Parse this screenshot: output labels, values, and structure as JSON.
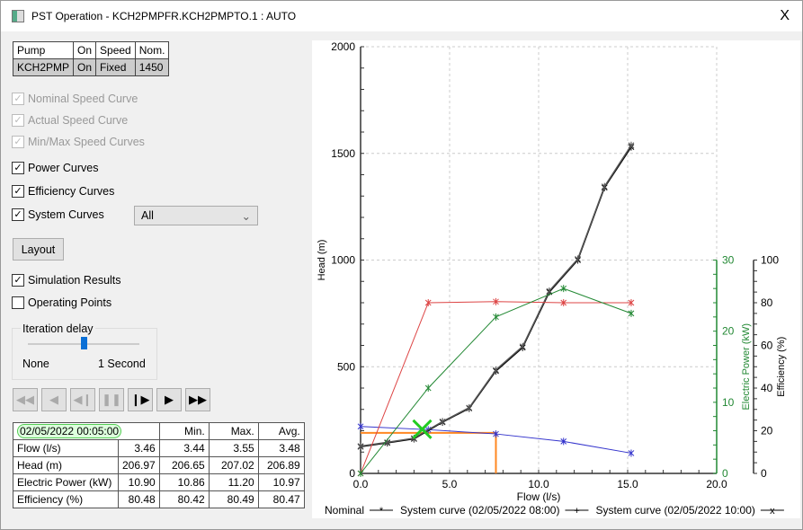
{
  "window": {
    "title": "PST Operation - KCH2PMPFR.KCH2PMPTO.1 : AUTO",
    "close": "X"
  },
  "pump_table": {
    "headers": [
      "Pump",
      "On",
      "Speed",
      "Nom."
    ],
    "row": [
      "KCH2PMP",
      "On",
      "Fixed",
      "1450"
    ],
    "on_color": "#11cc11"
  },
  "options": [
    {
      "label": "Nominal Speed Curve",
      "checked": true,
      "disabled": true
    },
    {
      "label": "Actual Speed Curve",
      "checked": true,
      "disabled": true
    },
    {
      "label": "Min/Max Speed Curves",
      "checked": true,
      "disabled": true
    },
    {
      "label": "Power Curves",
      "checked": true,
      "disabled": false
    },
    {
      "label": "Efficiency Curves",
      "checked": true,
      "disabled": false
    },
    {
      "label": "System Curves",
      "checked": true,
      "disabled": false
    }
  ],
  "system_curves_select": {
    "value": "All"
  },
  "layout_button": "Layout",
  "simulation_results": {
    "label": "Simulation Results",
    "checked": true
  },
  "operating_points": {
    "label": "Operating Points",
    "checked": false
  },
  "iteration_delay": {
    "label": "Iteration delay",
    "min_label": "None",
    "max_label": "1 Second",
    "value_fraction": 0.5
  },
  "playback": {
    "buttons": [
      "rewind",
      "step-back",
      "step-back-frame",
      "pause",
      "step-forward",
      "play",
      "fast-forward"
    ]
  },
  "stats": {
    "timestamp": "02/05/2022 00:05:00",
    "headers": [
      "Min.",
      "Max.",
      "Avg."
    ],
    "rows": [
      {
        "label": "Flow (l/s)",
        "values": [
          "3.46",
          "3.44",
          "3.55",
          "3.48"
        ]
      },
      {
        "label": "Head (m)",
        "values": [
          "206.97",
          "206.65",
          "207.02",
          "206.89"
        ]
      },
      {
        "label": "Electric Power (kW)",
        "values": [
          "10.90",
          "10.86",
          "11.20",
          "10.97"
        ]
      },
      {
        "label": "Efficiency (%)",
        "values": [
          "80.48",
          "80.42",
          "80.49",
          "80.47"
        ]
      }
    ]
  },
  "chart_data": {
    "type": "line",
    "xlabel": "Flow (l/s)",
    "ylabel": "Head (m)",
    "y2label": "Electric Power (kW)",
    "y3label": "Efficiency (%)",
    "xlim": [
      0,
      20
    ],
    "ylim": [
      0,
      2000
    ],
    "y2lim": [
      0,
      30
    ],
    "y3lim": [
      0,
      100
    ],
    "xticks": [
      "0.0",
      "5.0",
      "10.0",
      "15.0",
      "20.0"
    ],
    "yticks": [
      "0",
      "500",
      "1000",
      "1500",
      "2000"
    ],
    "y2ticks": [
      "0",
      "10",
      "20",
      "30"
    ],
    "y3ticks": [
      "0",
      "20",
      "40",
      "60",
      "80",
      "100"
    ],
    "grid": true,
    "legend_position": "bottom",
    "legend": [
      "Nominal",
      "System curve (02/05/2022 08:00)",
      "System curve (02/05/2022 10:00)"
    ],
    "series": [
      {
        "name": "Nominal",
        "axis": "head",
        "color": "#3333cc",
        "x": [
          0,
          3.8,
          7.6,
          11.4,
          15.2
        ],
        "y": [
          220,
          205,
          185,
          150,
          95
        ]
      },
      {
        "name": "System curve (02/05/2022 08:00)",
        "axis": "head",
        "color": "#000000",
        "x": [
          0,
          1.5,
          3.0,
          4.6,
          6.1,
          7.6,
          9.1,
          10.6,
          12.2,
          13.7,
          15.2
        ],
        "y": [
          125,
          143,
          162,
          240,
          305,
          480,
          590,
          850,
          1000,
          1340,
          1530
        ]
      },
      {
        "name": "System curve (02/05/2022 10:00)",
        "axis": "head",
        "color": "#555555",
        "x": [
          0,
          1.5,
          3.0,
          4.6,
          6.1,
          7.6,
          9.1,
          10.6,
          12.2,
          13.7,
          15.2
        ],
        "y": [
          128,
          146,
          165,
          243,
          308,
          485,
          595,
          855,
          1005,
          1345,
          1538
        ]
      },
      {
        "axis": "efficiency",
        "color": "#dd4444",
        "x": [
          0,
          3.8,
          7.6,
          11.4,
          15.2
        ],
        "y": [
          0,
          80,
          80.5,
          80,
          80
        ]
      },
      {
        "axis": "power",
        "color": "#228833",
        "x": [
          0,
          3.8,
          7.6,
          11.4,
          15.2
        ],
        "y": [
          0,
          12,
          22,
          26,
          22.5
        ]
      }
    ],
    "operating_guide": {
      "color": "#ff8822",
      "flow": 7.6,
      "head": 190
    },
    "operating_point": {
      "color": "#22cc22",
      "flow": 3.46,
      "head": 207
    }
  }
}
